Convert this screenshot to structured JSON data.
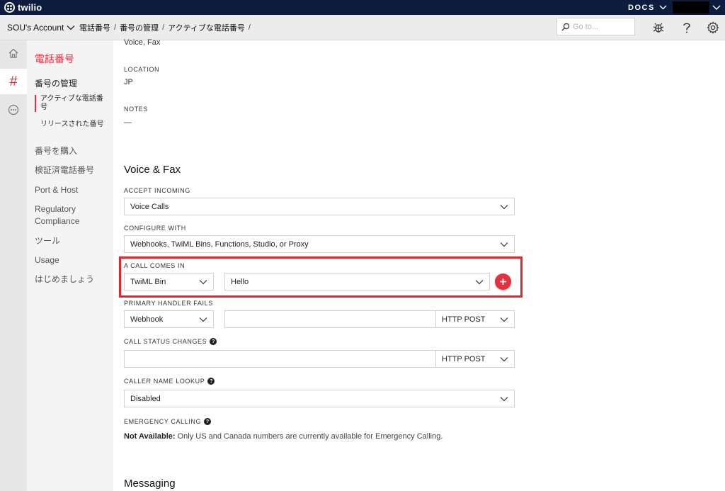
{
  "topbar": {
    "logo_text": "twilio",
    "docs_label": "DOCS"
  },
  "subbar": {
    "account_label": "SOU's Account",
    "breadcrumbs": [
      "電話番号",
      "番号の管理",
      "アクティブな電話番号"
    ],
    "search_placeholder": "Go to..."
  },
  "sidenav": {
    "title": "電話番号",
    "group_label": "番号の管理",
    "sub_items": [
      {
        "label": "アクティブな電話番号",
        "active": true
      },
      {
        "label": "リリースされた番号",
        "active": false
      }
    ],
    "items": [
      "番号を購入",
      "検証済電話番号",
      "Port & Host",
      "Regulatory Compliance",
      "ツール",
      "Usage",
      "はじめましょう"
    ]
  },
  "main": {
    "capabilities_value": "Voice, Fax",
    "location_label": "LOCATION",
    "location_value": "JP",
    "notes_label": "NOTES",
    "notes_value": "—",
    "voice_fax_heading": "Voice & Fax",
    "accept_incoming": {
      "label": "ACCEPT INCOMING",
      "value": "Voice Calls"
    },
    "configure_with": {
      "label": "CONFIGURE WITH",
      "value": "Webhooks, TwiML Bins, Functions, Studio, or Proxy"
    },
    "call_comes_in": {
      "label": "A CALL COMES IN",
      "type_value": "TwiML Bin",
      "bin_value": "Hello"
    },
    "primary_handler_fails": {
      "label": "PRIMARY HANDLER FAILS",
      "type_value": "Webhook",
      "url_value": "",
      "method_value": "HTTP POST"
    },
    "call_status_changes": {
      "label": "CALL STATUS CHANGES",
      "url_value": "",
      "method_value": "HTTP POST"
    },
    "caller_name_lookup": {
      "label": "CALLER NAME LOOKUP",
      "value": "Disabled"
    },
    "emergency_calling": {
      "label": "EMERGENCY CALLING",
      "status_label": "Not Available:",
      "status_text": "Only US and Canada numbers are currently available for Emergency Calling."
    },
    "messaging_heading": "Messaging"
  },
  "colors": {
    "brand_red": "#e5303f",
    "topbar_navy": "#0d1b3e",
    "highlight_red": "#e5242b"
  }
}
